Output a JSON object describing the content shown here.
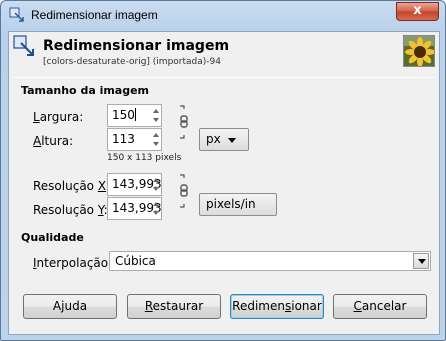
{
  "window": {
    "title": "Redimensionar imagem",
    "close_glyph": "x"
  },
  "header": {
    "title": "Redimensionar imagem",
    "subtitle": "[colors-desaturate-orig] (importada)-94",
    "icon": "resize-icon",
    "thumbnail": "sunflower-thumbnail"
  },
  "image_size": {
    "section_title": "Tamanho da imagem",
    "width_label_prefix": "",
    "width_label_accel": "L",
    "width_label_rest": "argura:",
    "width_value": "150",
    "height_label_accel": "A",
    "height_label_rest": "ltura:",
    "height_value": "113",
    "size_info": "150 x 113 pixels",
    "unit": "px",
    "res_x_label_prefix": "Resolução ",
    "res_x_label_accel": "X",
    "res_x_label_rest": ":",
    "res_x_value": "143,993",
    "res_y_label_prefix": "Resolução ",
    "res_y_label_accel": "Y",
    "res_y_label_rest": ":",
    "res_y_value": "143,993",
    "res_unit": "pixels/in"
  },
  "quality": {
    "section_title": "Qualidade",
    "interp_label_accel": "I",
    "interp_label_rest": "nterpolação:",
    "interp_value": "Cúbica"
  },
  "buttons": {
    "help_accel": "j",
    "help_pre": "A",
    "help_post": "uda",
    "reset_accel": "R",
    "reset_rest": "estaurar",
    "resize_pre": "Redimen",
    "resize_accel": "s",
    "resize_post": "ionar",
    "cancel_accel": "C",
    "cancel_rest": "ancelar"
  }
}
